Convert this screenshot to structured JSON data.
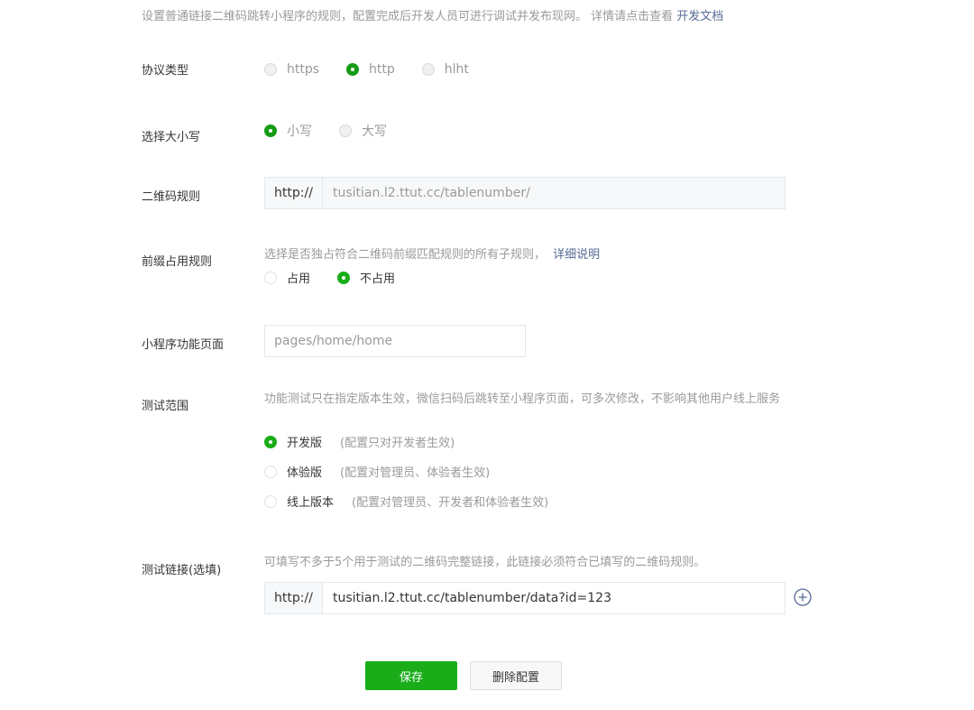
{
  "intro": {
    "text": "设置普通链接二维码跳转小程序的规则，配置完成后开发人员可进行调试并发布现网。 详情请点击查看",
    "link": "开发文档"
  },
  "protocol": {
    "label": "协议类型",
    "options": [
      "https",
      "http",
      "hlht"
    ],
    "selected": "http"
  },
  "case": {
    "label": "选择大小写",
    "options": [
      "小写",
      "大写"
    ],
    "selected": "小写"
  },
  "qr_rule": {
    "label": "二维码规则",
    "prefix": "http://",
    "value": "tusitian.l2.ttut.cc/tablenumber/"
  },
  "prefix_rule": {
    "label": "前缀占用规则",
    "hint": "选择是否独占符合二维码前缀匹配规则的所有子规则，",
    "hint_link": "详细说明",
    "options": [
      "占用",
      "不占用"
    ],
    "selected": "不占用"
  },
  "page_path": {
    "label": "小程序功能页面",
    "placeholder": "pages/home/home"
  },
  "test_scope": {
    "label": "测试范围",
    "hint": "功能测试只在指定版本生效，微信扫码后跳转至小程序页面，可多次修改，不影响其他用户线上服务",
    "options": [
      {
        "name": "开发版",
        "note": "(配置只对开发者生效)"
      },
      {
        "name": "体验版",
        "note": "(配置对管理员、体验者生效)"
      },
      {
        "name": "线上版本",
        "note": "(配置对管理员、开发者和体验者生效)"
      }
    ],
    "selected": "开发版"
  },
  "test_link": {
    "label": "测试链接(选填)",
    "hint": "可填写不多于5个用于测试的二维码完整链接，此链接必须符合已填写的二维码规则。",
    "prefix": "http://",
    "value": "tusitian.l2.ttut.cc/tablenumber/data?id=123"
  },
  "actions": {
    "save": "保存",
    "delete": "删除配置"
  },
  "colors": {
    "accent": "#1aad19",
    "link": "#576b95"
  }
}
